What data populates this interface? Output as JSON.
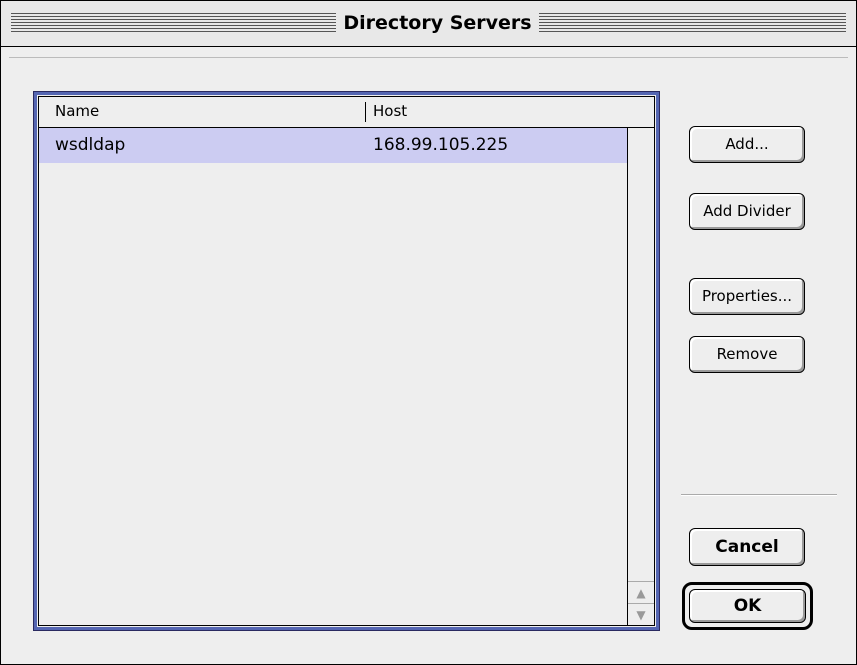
{
  "window": {
    "title": "Directory Servers"
  },
  "list": {
    "columns": [
      "Name",
      "Host"
    ],
    "rows": [
      {
        "name": "wsdldap",
        "host": "168.99.105.225",
        "selected": true
      }
    ]
  },
  "buttons": {
    "add": "Add...",
    "add_divider": "Add Divider",
    "properties": "Properties...",
    "remove": "Remove",
    "cancel": "Cancel",
    "ok": "OK"
  },
  "colors": {
    "selection": "#ccccf2",
    "focus_border": "#5566b2"
  },
  "icons": {
    "scroll_up": "triangle-up-icon",
    "scroll_down": "triangle-down-icon"
  }
}
